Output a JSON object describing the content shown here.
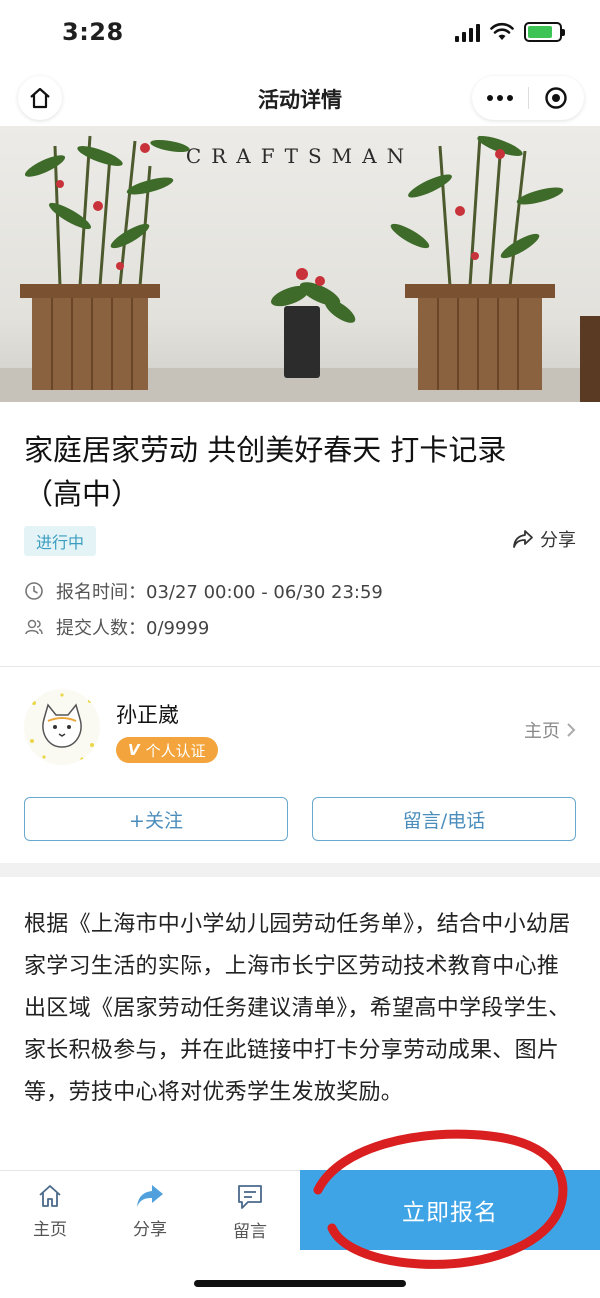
{
  "status_bar": {
    "time": "3:28"
  },
  "nav": {
    "title": "活动详情",
    "home_icon": "home-icon",
    "more_icon": "more-dots-icon",
    "close_icon": "target-icon"
  },
  "banner": {
    "sign_text": "CRAFTSMAN"
  },
  "activity": {
    "title": "家庭居家劳动 共创美好春天 打卡记录（高中）",
    "status_tag": "进行中",
    "share_label": "分享",
    "signup_time_label": "报名时间：",
    "signup_time_value": "03/27 00:00 - 06/30 23:59",
    "submitters_label": "提交人数：",
    "submitters_value": "0/9999"
  },
  "author": {
    "name": "孙正崴",
    "badge_label": "个人认证",
    "badge_letter": "V",
    "homepage_label": "主页",
    "follow_button": "+关注",
    "message_button": "留言/电话"
  },
  "description": {
    "text": "根据《上海市中小学幼儿园劳动任务单》，结合中小幼居家学习生活的实际，上海市长宁区劳动技术教育中心推出区域《居家劳动任务建议清单》，希望高中学段学生、家长积极参与，并在此链接中打卡分享劳动成果、图片等，劳技中心将对优秀学生发放奖励。"
  },
  "bottom_bar": {
    "tabs": [
      {
        "label": "主页",
        "icon": "home-icon"
      },
      {
        "label": "分享",
        "icon": "share-arrow-icon"
      },
      {
        "label": "留言",
        "icon": "message-icon"
      }
    ],
    "signup_button": "立即报名"
  },
  "colors": {
    "accent": "#3fa4e6",
    "status_tag_text": "#3b9ec0",
    "badge": "#f3a43c",
    "outline_button": "#6aa9cf",
    "annotation_red": "#d91f1f"
  }
}
